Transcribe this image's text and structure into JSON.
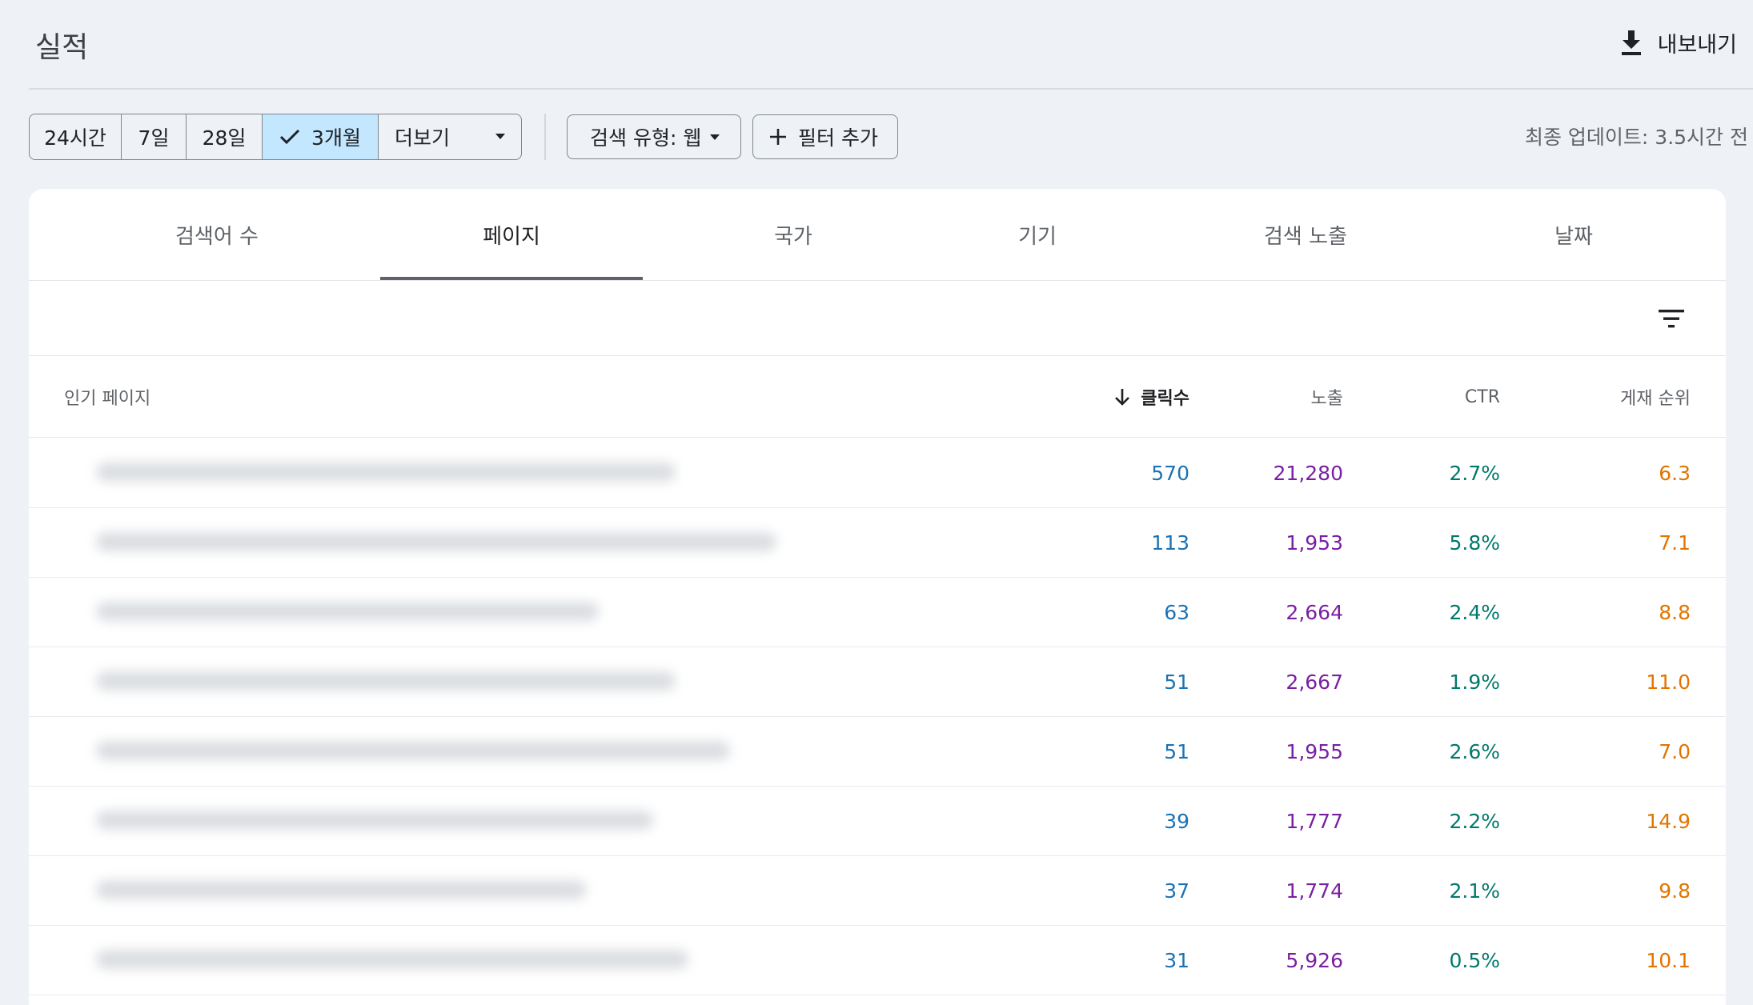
{
  "header": {
    "title": "실적",
    "export_label": "내보내기"
  },
  "date_range": {
    "options": [
      "24시간",
      "7일",
      "28일",
      "3개월"
    ],
    "more_label": "더보기",
    "selected": "3개월"
  },
  "search_type_label": "검색 유형: 웹",
  "add_filter_label": "필터 추가",
  "last_updated": "최종 업데이트: 3.5시간 전",
  "tabs": [
    {
      "label": "검색어 수"
    },
    {
      "label": "페이지"
    },
    {
      "label": "국가"
    },
    {
      "label": "기기"
    },
    {
      "label": "검색 노출"
    },
    {
      "label": "날짜"
    }
  ],
  "active_tab": "페이지",
  "table": {
    "headers": {
      "page": "인기 페이지",
      "clicks": "클릭수",
      "impressions": "노출",
      "ctr": "CTR",
      "position": "게재 순위"
    },
    "sort_column": "clicks",
    "sort_direction": "desc",
    "rows": [
      {
        "url": "",
        "clicks": "570",
        "impressions": "21,280",
        "ctr": "2.7%",
        "position": "6.3"
      },
      {
        "url": "",
        "clicks": "113",
        "impressions": "1,953",
        "ctr": "5.8%",
        "position": "7.1"
      },
      {
        "url": "",
        "clicks": "63",
        "impressions": "2,664",
        "ctr": "2.4%",
        "position": "8.8"
      },
      {
        "url": "",
        "clicks": "51",
        "impressions": "2,667",
        "ctr": "1.9%",
        "position": "11.0"
      },
      {
        "url": "",
        "clicks": "51",
        "impressions": "1,955",
        "ctr": "2.6%",
        "position": "7.0"
      },
      {
        "url": "",
        "clicks": "39",
        "impressions": "1,777",
        "ctr": "2.2%",
        "position": "14.9"
      },
      {
        "url": "",
        "clicks": "37",
        "impressions": "1,774",
        "ctr": "2.1%",
        "position": "9.8"
      },
      {
        "url": "",
        "clicks": "31",
        "impressions": "5,926",
        "ctr": "0.5%",
        "position": "10.1"
      }
    ]
  },
  "colors": {
    "clicks": "#1a73b4",
    "impressions": "#7b1fa2",
    "ctr": "#00796b",
    "position": "#e37400",
    "selected_chip": "#c2e7ff"
  },
  "icons": [
    "download-icon",
    "check-icon",
    "dropdown-arrow-icon",
    "plus-icon",
    "filter-list-icon",
    "arrow-down-icon"
  ]
}
